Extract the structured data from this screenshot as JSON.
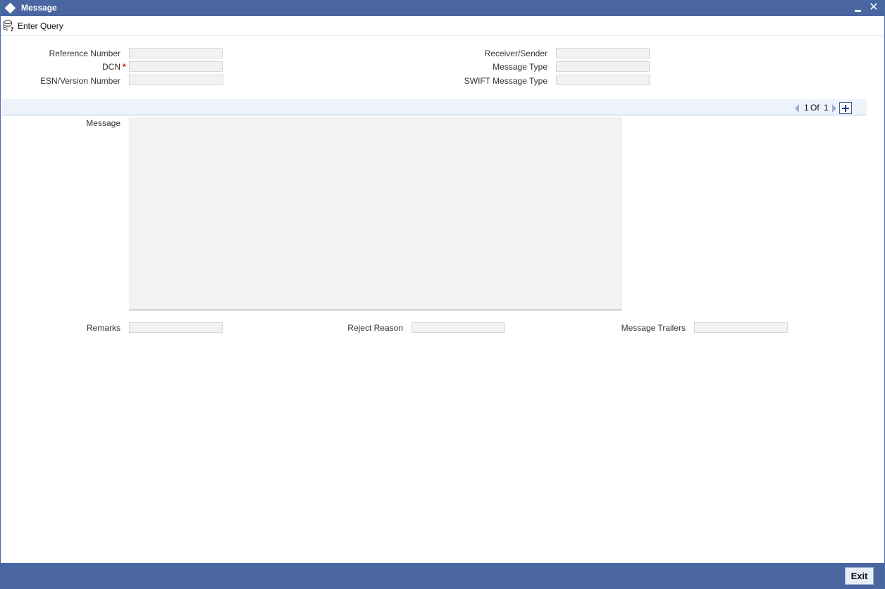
{
  "window": {
    "title": "Message"
  },
  "toolbar": {
    "enter_query": "Enter Query"
  },
  "form": {
    "reference_number": {
      "label": "Reference Number",
      "value": ""
    },
    "dcn": {
      "label": "DCN",
      "required_mark": "*",
      "value": ""
    },
    "esn_version": {
      "label": "ESN/Version Number",
      "value": ""
    },
    "receiver_sender": {
      "label": "Receiver/Sender",
      "value": ""
    },
    "message_type": {
      "label": "Message Type",
      "value": ""
    },
    "swift_message_type": {
      "label": "SWIFT Message Type",
      "value": ""
    }
  },
  "pager": {
    "current": "1",
    "of": "Of",
    "total": "1"
  },
  "message": {
    "label": "Message",
    "value": ""
  },
  "bottom": {
    "remarks": {
      "label": "Remarks",
      "value": ""
    },
    "reject_reason": {
      "label": "Reject Reason",
      "value": ""
    },
    "message_trailers": {
      "label": "Message Trailers",
      "value": ""
    }
  },
  "footer": {
    "exit_label": "Exit"
  },
  "colors": {
    "titlebar": "#4a66a1",
    "field_bg": "#f2f2f2",
    "band": "#eef2fb",
    "required": "#d40000"
  },
  "icons": {
    "window": "diamond-icon",
    "minimize": "minimize-icon",
    "close": "close-icon",
    "enter_query": "database-query-icon",
    "prev": "triangle-left-icon",
    "next": "triangle-right-icon",
    "add": "plus-icon"
  }
}
